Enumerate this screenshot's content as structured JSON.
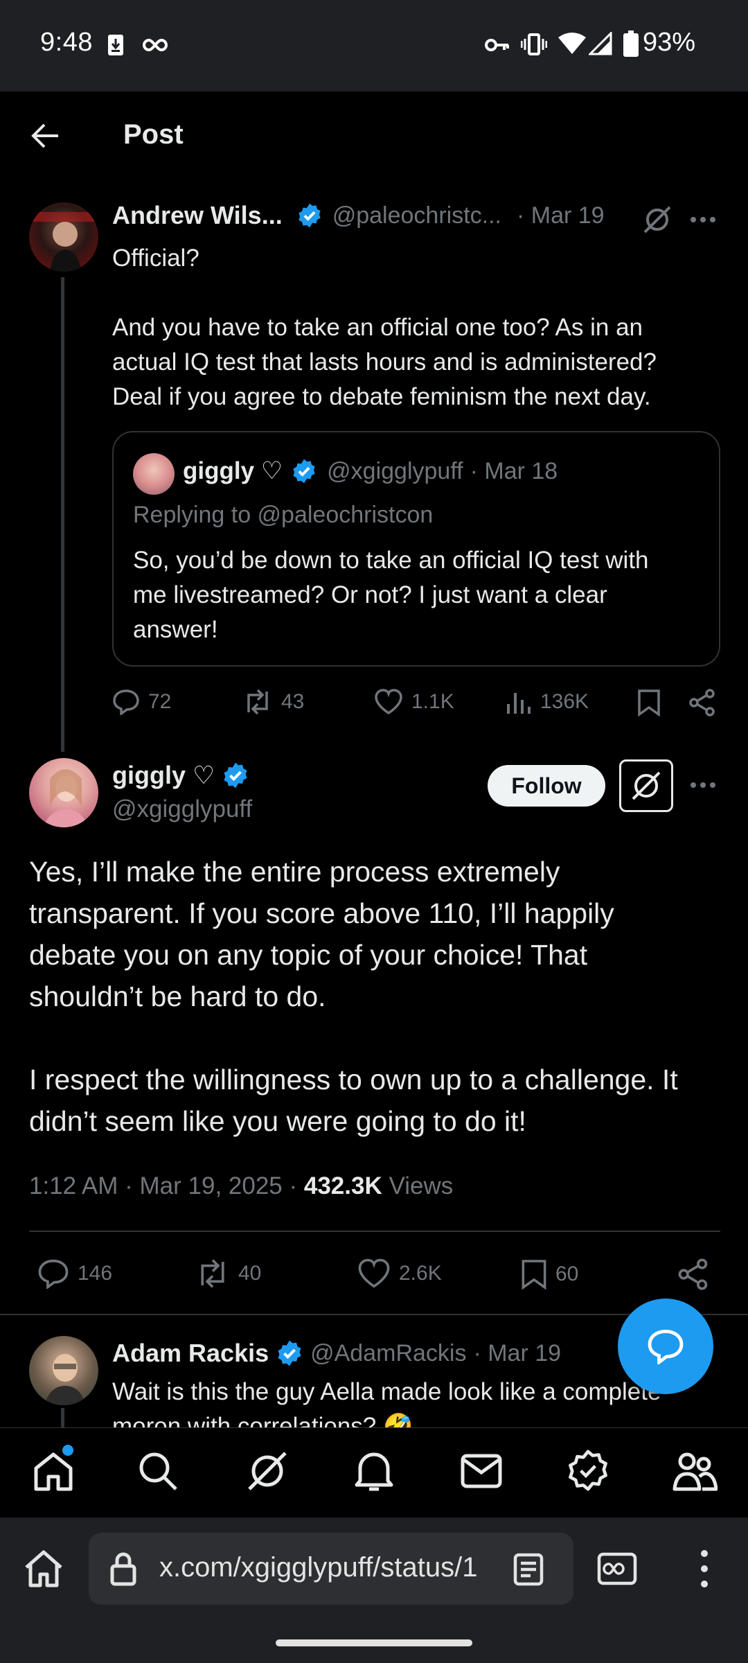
{
  "status_bar": {
    "time": "9:48",
    "battery": "93%"
  },
  "header": {
    "title": "Post"
  },
  "quoted_post": {
    "author_name": "Andrew Wils...",
    "handle": "@paleochristc...",
    "date": "· Mar 19",
    "line1": "Official?",
    "paragraph": [
      "And you have to take an official one too? As in an",
      "actual IQ test that lasts  hours and is administered?",
      "Deal if you agree to debate feminism the next day."
    ],
    "embed": {
      "author_name": "giggly ♡",
      "handle": "@xgigglypuff",
      "date": "· Mar 18",
      "replying_to": "Replying to @paleochristcon",
      "text": [
        "So, you’d be down to take an official IQ test with",
        "me livestreamed? Or not? I just want a clear",
        "answer!"
      ]
    },
    "stats": {
      "replies": "72",
      "reposts": "43",
      "likes": "1.1K",
      "views": "136K"
    }
  },
  "main_post": {
    "author_name": "giggly ♡",
    "handle": "@xgigglypuff",
    "follow_label": "Follow",
    "paragraph1": [
      "Yes, I’ll make the entire process extremely",
      "transparent. If you score above 110, I’ll happily",
      "debate you on any topic of your choice! That",
      "shouldn’t be hard to do."
    ],
    "paragraph2": [
      "I respect the willingness to own up to a challenge. It",
      "didn’t seem like you were going to do it!"
    ],
    "timestamp": "1:12 AM · Mar 19, 2025 · ",
    "views_count": "432.3K",
    "views_label": "Views",
    "stats": {
      "replies": "146",
      "reposts": "40",
      "likes": "2.6K",
      "bookmarks": "60"
    }
  },
  "reply_post": {
    "author_name": "Adam Rackis",
    "handle": "@AdamRackis",
    "date": "· Mar 19",
    "text": [
      "Wait is this the guy Aella made look like a complete",
      "moron with correlations? 🤣"
    ]
  },
  "browser": {
    "url": "x.com/xgigglypuff/status/1"
  },
  "colors": {
    "accent": "#1d9bf0",
    "verified": "#1d9bf0",
    "bg": "#000000",
    "muted": "#71767b"
  }
}
